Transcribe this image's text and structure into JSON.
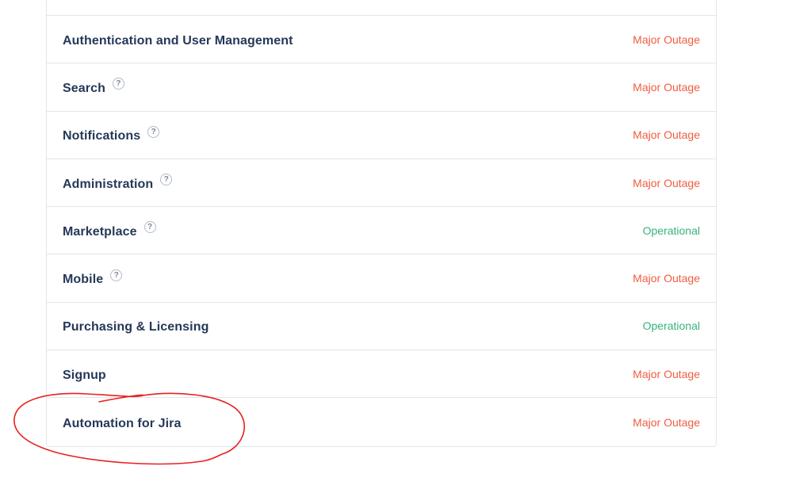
{
  "components": [
    {
      "name": "Authentication and User Management",
      "status": "Major Outage",
      "status_kind": "outage",
      "has_help": false
    },
    {
      "name": "Search",
      "status": "Major Outage",
      "status_kind": "outage",
      "has_help": true
    },
    {
      "name": "Notifications",
      "status": "Major Outage",
      "status_kind": "outage",
      "has_help": true
    },
    {
      "name": "Administration",
      "status": "Major Outage",
      "status_kind": "outage",
      "has_help": true
    },
    {
      "name": "Marketplace",
      "status": "Operational",
      "status_kind": "operational",
      "has_help": true
    },
    {
      "name": "Mobile",
      "status": "Major Outage",
      "status_kind": "outage",
      "has_help": true
    },
    {
      "name": "Purchasing & Licensing",
      "status": "Operational",
      "status_kind": "operational",
      "has_help": false
    },
    {
      "name": "Signup",
      "status": "Major Outage",
      "status_kind": "outage",
      "has_help": false
    },
    {
      "name": "Automation for Jira",
      "status": "Major Outage",
      "status_kind": "outage",
      "has_help": false
    }
  ],
  "help_icon_glyph": "?",
  "colors": {
    "outage": "#f25c40",
    "operational": "#36b37e",
    "component_text": "#253858",
    "annotation": "#e8201e"
  },
  "icons": {
    "help": "question-circle-icon"
  }
}
